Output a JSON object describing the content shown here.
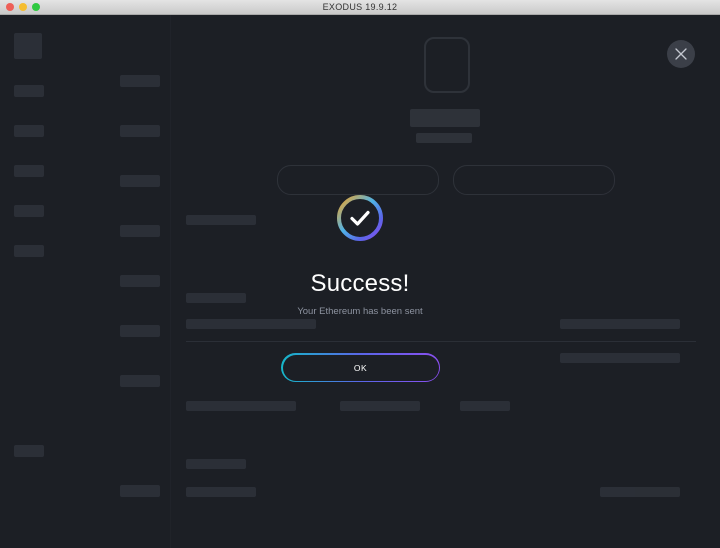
{
  "window": {
    "title": "EXODUS 19.9.12"
  },
  "modal": {
    "title": "Success!",
    "message": "Your Ethereum has been sent",
    "ok_label": "OK"
  },
  "icons": {
    "close": "close-icon",
    "success": "check-circle-icon"
  },
  "colors": {
    "background": "#1c1f25",
    "accent_gradient_start": "#16b7c9",
    "accent_gradient_mid": "#5a66e8",
    "accent_gradient_end": "#8a4ff0",
    "ring_orange": "#f5a524",
    "ring_purple": "#8a4ff0"
  }
}
